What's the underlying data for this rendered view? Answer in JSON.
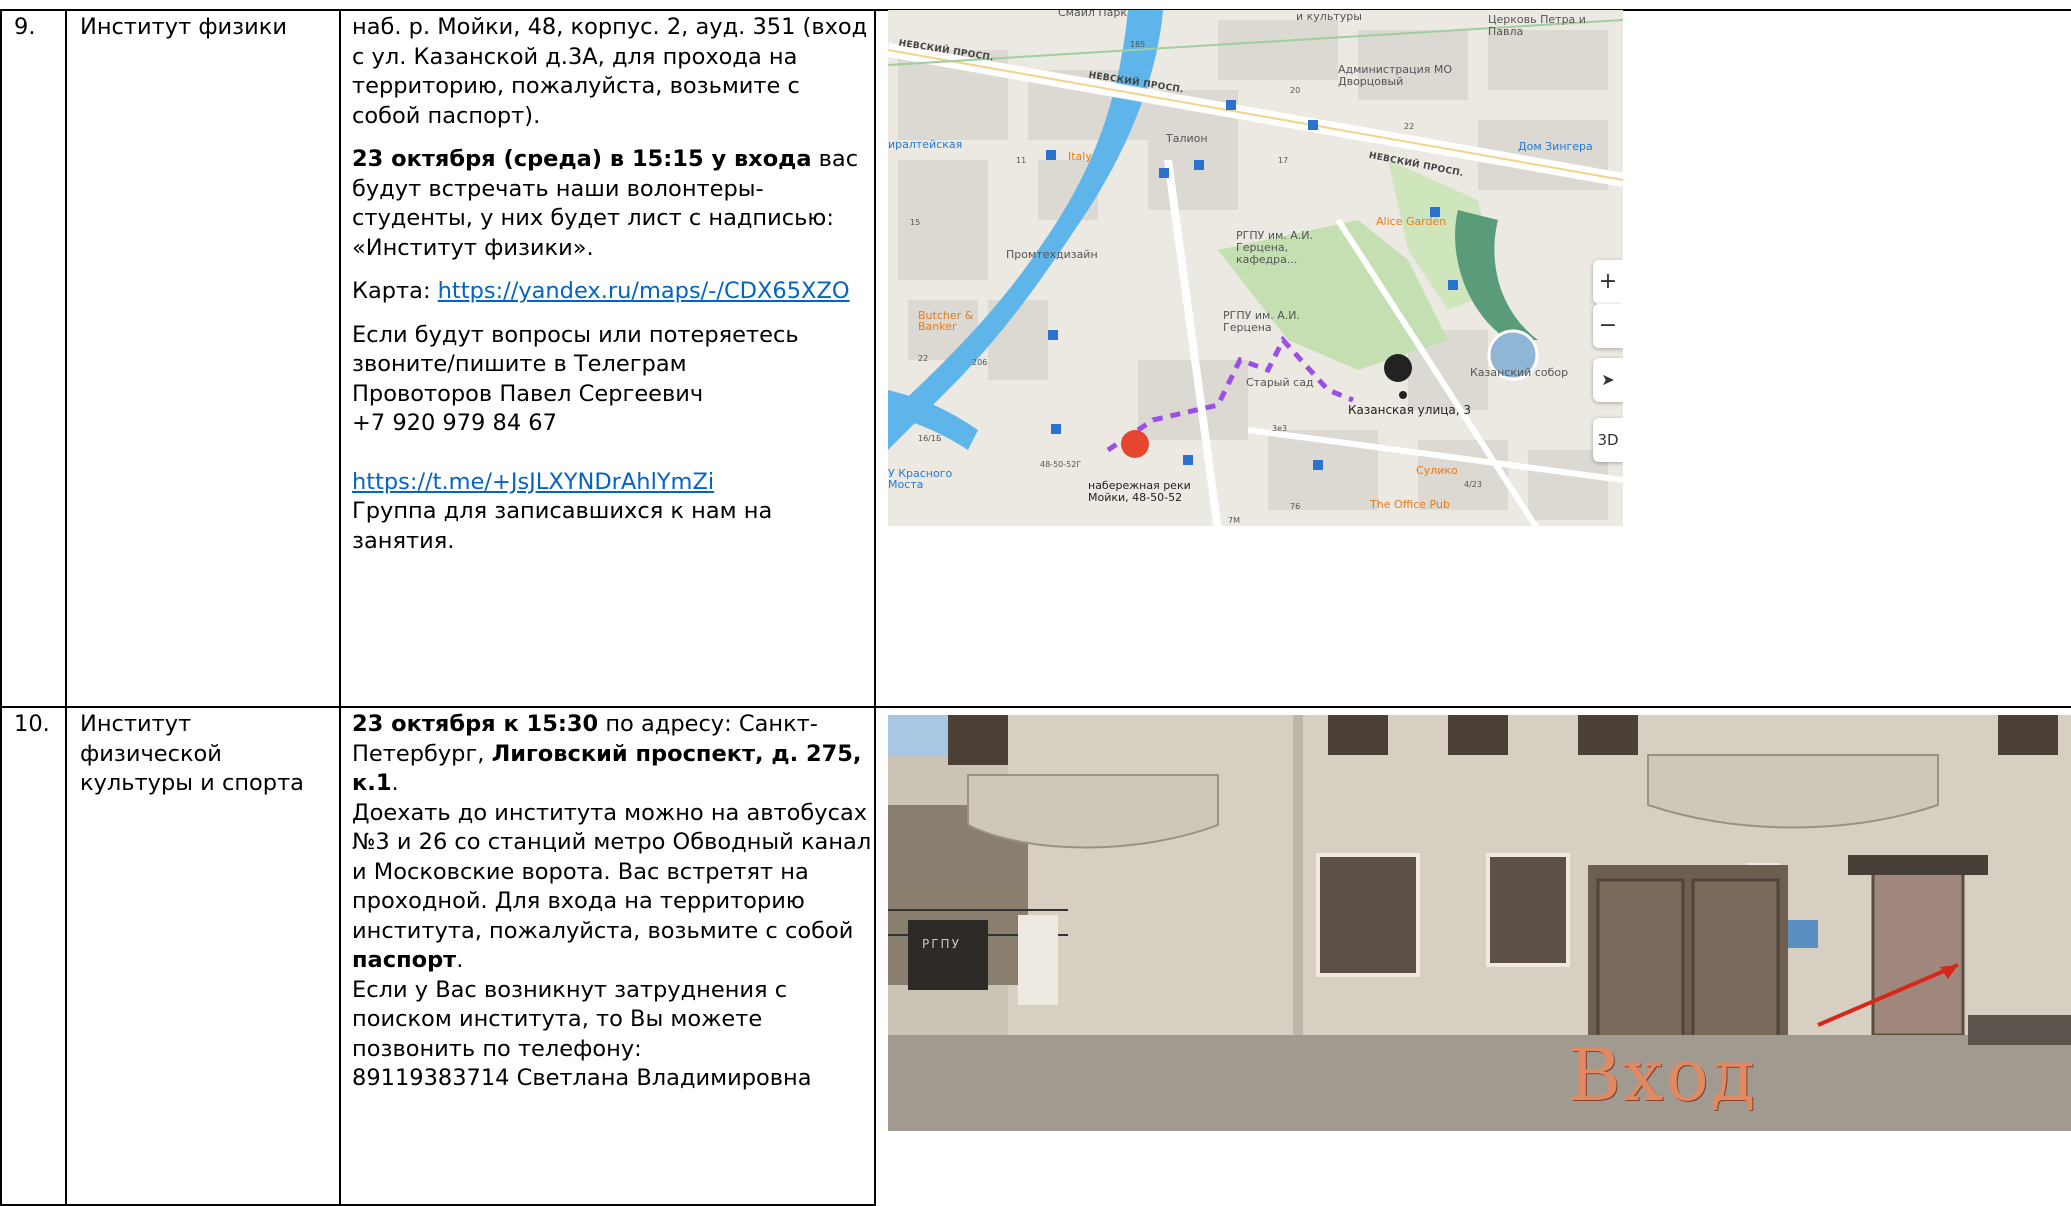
{
  "rows": [
    {
      "number": "9.",
      "institute": "Институт физики",
      "address": "наб. р. Мойки, 48, корпус. 2, ауд. 351 (вход с ул. Казанской д.3А, для прохода на территорию, пожалуйста, возьмите с собой паспорт).",
      "meet_bold": "23 октября (среда) в 15:15 у входа",
      "meet_rest": " вас будут встречать наши волонтеры-студенты, у них будет лист с надписью: «Институт физики».",
      "map_label": "Карта: ",
      "map_link": "https://yandex.ru/maps/-/CDX65XZO",
      "questions": "Если будут вопросы или потеряетесь звоните/пишите в Телеграм",
      "contact_name": "Провоторов Павел Сергеевич",
      "contact_phone": "+7 920 979 84 67",
      "tg_link": "https://t.me/+JsJLXYNDrAhlYmZi",
      "group_text": "Группа для записавшихся к нам на занятия."
    },
    {
      "number": "10.",
      "institute": "Институт физической культуры и спорта",
      "date_bold": "23 октября к 15:30",
      "addr_prefix": " по адресу: Санкт-Петербург, ",
      "addr_bold": "Лиговский проспект, д. 275, к.1",
      "addr_end": ".",
      "transport": "Доехать до института можно на автобусах №3 и 26 со станций метро Обводный канал и Московские ворота. Вас встретят на проходной. Для входа на территорию института, пожалуйста, возьмите с собой ",
      "passport_bold": "паспорт",
      "passport_end": ".",
      "help": "Если у Вас возникнут затруднения с поиском института, то Вы можете позвонить по телефону:",
      "phone_contact": "89119383714 Светлана Владимировна"
    }
  ],
  "map": {
    "labels": {
      "nevsky1": "НЕВСКИЙ ПРОСП.",
      "nevsky2": "НЕВСКИЙ ПРОСП.",
      "nevsky3": "НЕВСКИЙ ПРОСП.",
      "church": "Церковь Петра и Павла",
      "admin": "Администрация МО Дворцовый",
      "culture": "и культуры",
      "park": "Смайл Парк",
      "admiralty": "иралтейская",
      "italy": "Italy",
      "talion": "Талион",
      "singer": "Дом Зингера",
      "alice": "Alice Garden",
      "rgpu1": "РГПУ им. А.И. Герцена, кафедра...",
      "promtech": "Промтехдизайн",
      "rgpu2": "РГПУ им. А.И. Герцена",
      "butcher": "Butcher & Banker",
      "old_garden": "Старый сад",
      "kazan_cathedral": "Казанский собор",
      "kazan_street": "Казанская улица, 3",
      "red_bridge": "У Красного Моста",
      "moika": "набережная реки Мойки, 48-50-52",
      "suliko": "Сулико",
      "office_pub": "The Office Pub",
      "n185": "185",
      "n20": "20",
      "n22": "22",
      "n11": "11",
      "n17": "17",
      "n15": "15",
      "n206": "206",
      "n22b": "22",
      "n16": "16/1Б",
      "n4850": "48-50-52Г",
      "n3e3": "3е3",
      "n4_23": "4/23",
      "n76": "76",
      "n7m": "7М"
    },
    "controls": {
      "zoom_in": "+",
      "zoom_out": "−",
      "locate": "➤",
      "view3d": "3D"
    }
  },
  "photo": {
    "sign": "Вход",
    "plaque": "РГПУ"
  }
}
